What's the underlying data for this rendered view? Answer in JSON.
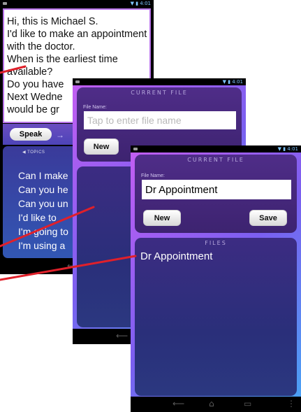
{
  "screen1": {
    "message_lines": [
      "Hi, this is Michael S.",
      "I'd like to make an appointment",
      "with the doctor.",
      "When is the earliest time",
      "available?",
      "Do you have",
      "Next Wedne",
      "would be gr"
    ],
    "speak_label": "Speak",
    "arrow_glyph": "→",
    "topics_label": "◀ TOPICS",
    "topic_items": [
      "Can I make",
      "Can you he",
      "Can you un",
      "I'd like to",
      "I'm going to",
      "I'm using a"
    ]
  },
  "screen2": {
    "current_file_title": "CURRENT FILE",
    "file_name_label": "File Name:",
    "file_name_placeholder": "Tap to enter file name",
    "new_label": "New"
  },
  "screen3": {
    "current_file_title": "CURRENT FILE",
    "file_name_label": "File Name:",
    "file_name_value": "Dr Appointment",
    "new_label": "New",
    "save_label": "Save",
    "files_title": "FILES",
    "files": [
      "Dr Appointment"
    ]
  },
  "status_icons": "▼ ▮ 4:01",
  "nav_icons": {
    "back": "⟵",
    "home": "⌂",
    "recent": "▭",
    "menu": "⋮"
  },
  "colors": {
    "callout_line": "#e0202a",
    "current_file_panel": "#4f2d88",
    "files_panel": "#2a2f7a",
    "phone_frame_glow": "#c65cf0"
  }
}
